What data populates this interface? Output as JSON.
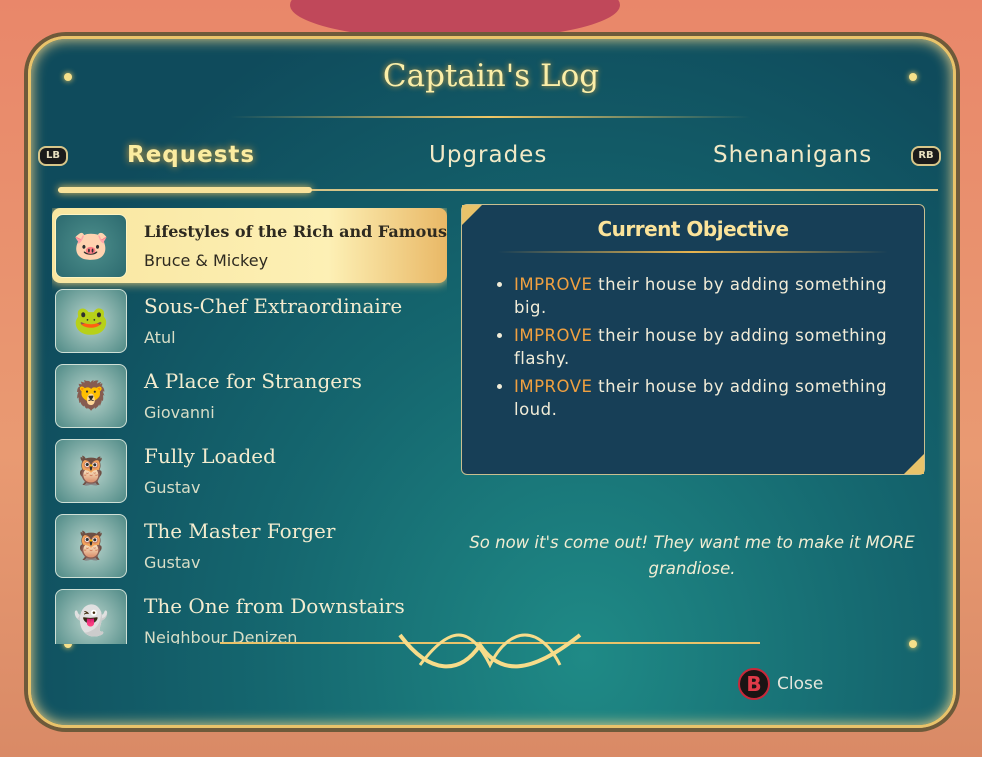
{
  "title": "Captain's Log",
  "tabs": {
    "left_button": "LB",
    "right_button": "RB",
    "items": [
      {
        "label": "Requests",
        "active": true
      },
      {
        "label": "Upgrades"
      },
      {
        "label": "Shenanigans"
      }
    ]
  },
  "requests": [
    {
      "name": "Lifestyles of the Rich and Famous",
      "person": "Bruce & Mickey",
      "icon": "pig-bird-portrait",
      "selected": true
    },
    {
      "name": "Sous-Chef Extraordinaire",
      "person": "Atul",
      "icon": "frog-portrait"
    },
    {
      "name": "A Place for Strangers",
      "person": "Giovanni",
      "icon": "lion-portrait"
    },
    {
      "name": "Fully Loaded",
      "person": "Gustav",
      "icon": "owl-portrait"
    },
    {
      "name": "The Master Forger",
      "person": "Gustav",
      "icon": "owl-portrait"
    },
    {
      "name": "The One from Downstairs",
      "person": "Neighbour Denizen",
      "icon": "ghost-portrait"
    }
  ],
  "objective": {
    "title": "Current Objective",
    "items": [
      {
        "keyword": "IMPROVE",
        "text": " their house by adding something big."
      },
      {
        "keyword": "IMPROVE",
        "text": " their house by adding something flashy."
      },
      {
        "keyword": "IMPROVE",
        "text": " their house by adding something loud."
      }
    ]
  },
  "quote": "So now it's come out! They want me to make it MORE grandiose.",
  "close": {
    "button": "B",
    "label": "Close"
  },
  "colors": {
    "accent": "#f0a040",
    "gold": "#e9c36a",
    "panel": "#15676f"
  }
}
